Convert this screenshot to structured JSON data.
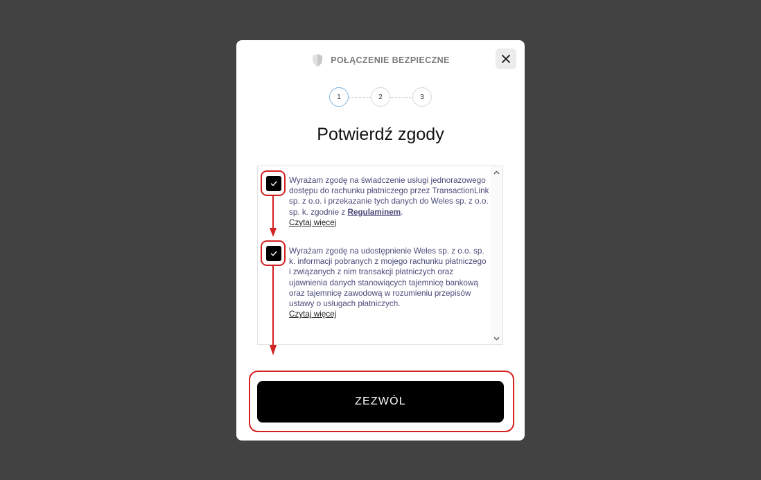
{
  "header": {
    "secure_label": "POŁĄCZENIE BEZPIECZNE",
    "shield_icon": "shield-icon",
    "close_icon": "close-icon"
  },
  "steps": [
    "1",
    "2",
    "3"
  ],
  "active_step": 1,
  "title": "Potwierdź zgody",
  "consents": [
    {
      "text_before": "Wyrażam zgodę na świadczenie usługi jednorazowego dostępu do rachunku płatniczego przez TransactionLink sp. z o.o. i przekazanie tych danych do Weles sp. z o.o. sp. k. zgodnie z ",
      "link": "Regulaminem",
      "text_after": ".",
      "read_more": "Czytaj więcej",
      "checked": true
    },
    {
      "text_before": "Wyrażam zgodę na udostępnienie Weles sp. z o.o. sp. k. informacji pobranych z mojego rachunku płatniczego i związanych z nim transakcji płatniczych oraz ujawnienia danych stanowiących tajemnicę bankową oraz tajemnicę zawodową w rozumieniu przepisów ustawy o usługach płatniczych.",
      "read_more": "Czytaj więcej",
      "checked": true
    }
  ],
  "allow_button": "ZEZWÓL",
  "colors": {
    "backdrop": "#424242",
    "annotation_red": "#d32020",
    "active_step": "#7fb4de"
  }
}
